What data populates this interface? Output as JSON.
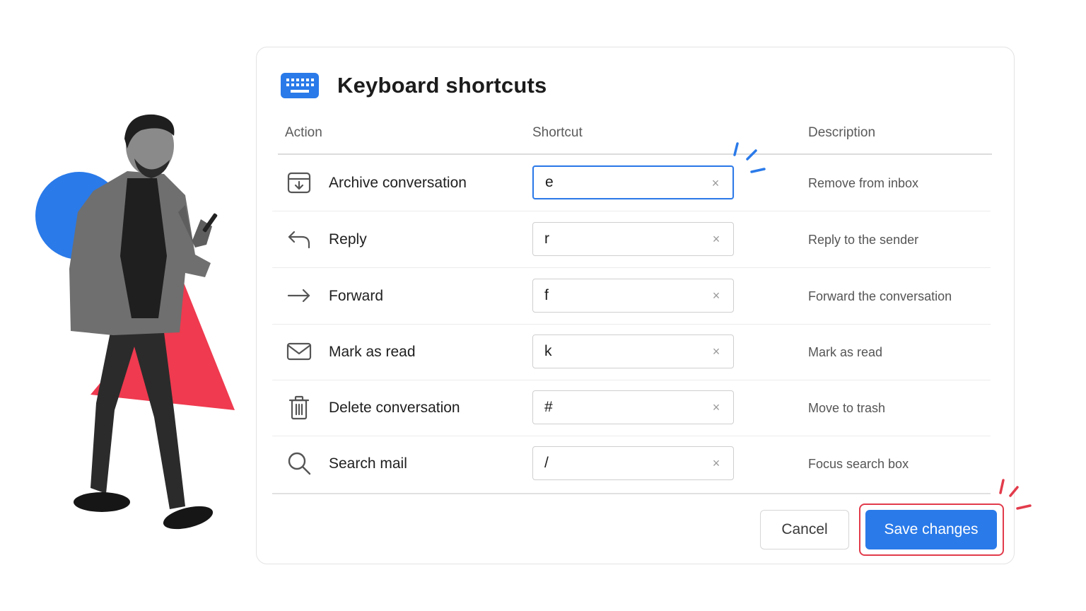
{
  "dialog": {
    "title": "Keyboard shortcuts",
    "icon": "keyboard-icon"
  },
  "columns": {
    "action": "Action",
    "shortcut": "Shortcut",
    "description": "Description"
  },
  "rows": [
    {
      "icon": "archive-icon",
      "action": "Archive conversation",
      "shortcut": "e",
      "description": "Remove from inbox",
      "focused": true
    },
    {
      "icon": "reply-icon",
      "action": "Reply",
      "shortcut": "r",
      "description": "Reply to the sender"
    },
    {
      "icon": "forward-icon",
      "action": "Forward",
      "shortcut": "f",
      "description": "Forward the conversation"
    },
    {
      "icon": "mail-icon",
      "action": "Mark as read",
      "shortcut": "k",
      "description": "Mark as read"
    },
    {
      "icon": "trash-icon",
      "action": "Delete conversation",
      "shortcut": "#",
      "description": "Move to trash"
    },
    {
      "icon": "search-icon",
      "action": "Search mail",
      "shortcut": "/",
      "description": "Focus search box"
    }
  ],
  "clear_glyph": "×",
  "buttons": {
    "cancel": "Cancel",
    "save": "Save changes"
  },
  "colors": {
    "accent": "#2a7ae9",
    "highlight": "#e23b4b",
    "shape_blue": "#2a7ae9",
    "shape_red": "#ef3a4f"
  }
}
